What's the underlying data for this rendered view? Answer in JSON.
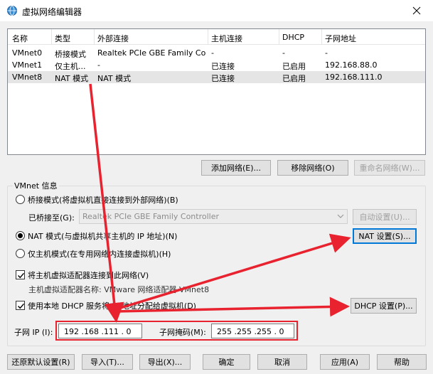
{
  "window": {
    "title": "虚拟网络编辑器"
  },
  "net_list": {
    "headers": [
      "名称",
      "类型",
      "外部连接",
      "主机连接",
      "DHCP",
      "子网地址"
    ],
    "rows": [
      [
        "VMnet0",
        "桥接模式",
        "Realtek PCIe GBE Family Co...",
        "-",
        "-",
        "-"
      ],
      [
        "VMnet1",
        "仅主机...",
        "-",
        "已连接",
        "已启用",
        "192.168.88.0"
      ],
      [
        "VMnet8",
        "NAT 模式",
        "NAT 模式",
        "已连接",
        "已启用",
        "192.168.111.0"
      ]
    ]
  },
  "list_buttons": {
    "add": "添加网络(E)...",
    "remove": "移除网络(O)",
    "rename": "重命名网络(W)..."
  },
  "vmnet_info": {
    "group_title": "VMnet 信息",
    "bridge_mode": "桥接模式(将虚拟机直接连接到外部网络)(B)",
    "bridged_to_label": "已桥接至(G):",
    "bridged_to_value": "Realtek PCIe GBE Family Controller",
    "auto_settings": "自动设置(U)...",
    "nat_mode": "NAT 模式(与虚拟机共享主机的 IP 地址)(N)",
    "nat_settings": "NAT 设置(S)...",
    "host_only": "仅主机模式(在专用网络内连接虚拟机)(H)",
    "connect_adapter": "将主机虚拟适配器连接到此网络(V)",
    "adapter_name": "主机虚拟适配器名称: VMware 网络适配器 VMnet8",
    "use_dhcp": "使用本地 DHCP 服务将 IP 地址分配给虚拟机(D)",
    "dhcp_settings": "DHCP 设置(P)...",
    "subnet_ip_label": "子网 IP (I):",
    "subnet_ip": "192 .168 .111 . 0",
    "subnet_mask_label": "子网掩码(M):",
    "subnet_mask": "255 .255 .255 . 0"
  },
  "bottom_buttons": {
    "restore": "还原默认设置(R)",
    "import": "导入(T)...",
    "export": "导出(X)...",
    "ok": "确定",
    "cancel": "取消",
    "apply": "应用(A)",
    "help": "帮助"
  },
  "colors": {
    "annotation": "#e8232f",
    "selection": "#e5e5e5",
    "focus": "#0078d7"
  },
  "icons": {
    "app": "network-globe-icon",
    "close": "close-icon",
    "dropdown": "chevron-down-icon"
  }
}
